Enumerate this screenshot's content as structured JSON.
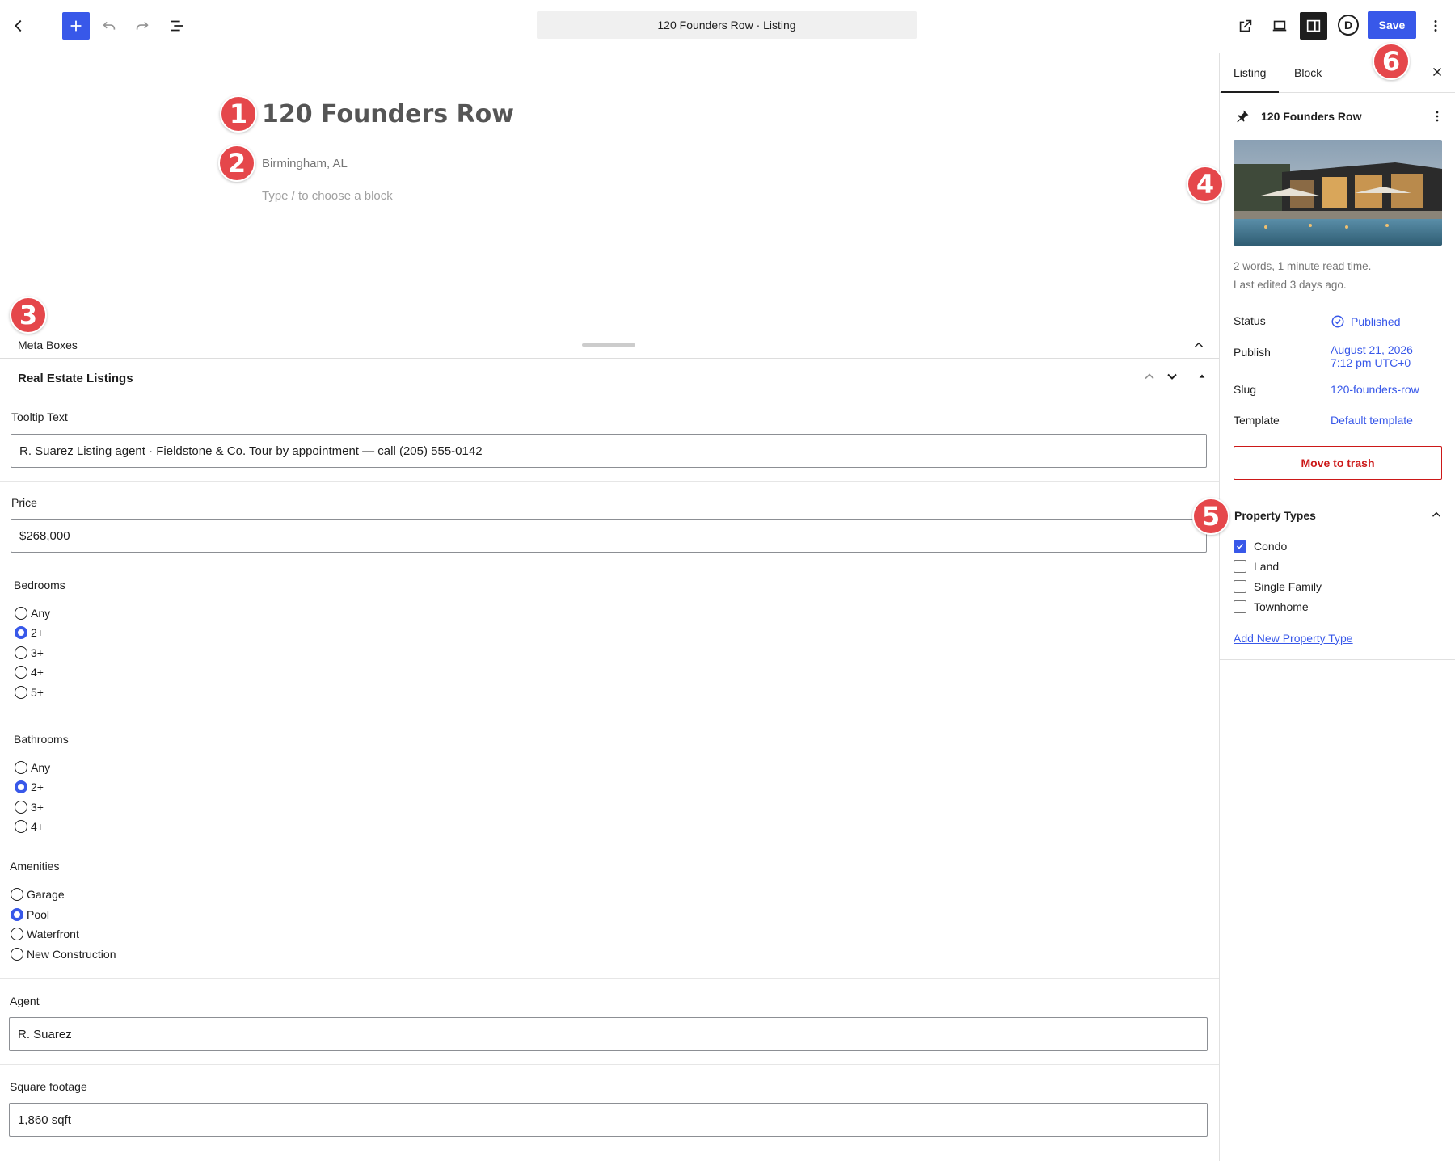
{
  "header": {
    "document_title": "120 Founders Row · Listing",
    "save_label": "Save",
    "avatar_letter": "D"
  },
  "editor": {
    "title": "120 Founders Row",
    "subtitle": "Birmingham, AL",
    "placeholder": "Type / to choose a block"
  },
  "annotations": [
    "1",
    "2",
    "3",
    "4",
    "5",
    "6"
  ],
  "meta_boxes": {
    "label": "Meta Boxes",
    "box_title": "Real Estate Listings",
    "tooltip": {
      "label": "Tooltip Text",
      "value": "R. Suarez Listing agent · Fieldstone & Co. Tour by appointment — call (205) 555-0142"
    },
    "price": {
      "label": "Price",
      "value": "$268,000"
    },
    "bedrooms": {
      "label": "Bedrooms",
      "options": [
        "Any",
        "2+",
        "3+",
        "4+",
        "5+"
      ],
      "selected": "2+"
    },
    "bathrooms": {
      "label": "Bathrooms",
      "options": [
        "Any",
        "2+",
        "3+",
        "4+"
      ],
      "selected": "2+"
    },
    "amenities": {
      "label": "Amenities",
      "options": [
        "Garage",
        "Pool",
        "Waterfront",
        "New Construction"
      ],
      "selected": "Pool"
    },
    "agent": {
      "label": "Agent",
      "value": "R. Suarez"
    },
    "square_footage": {
      "label": "Square footage",
      "value": "1,860 sqft"
    }
  },
  "sidebar": {
    "tabs": [
      "Listing",
      "Block"
    ],
    "active_tab": "Listing",
    "post_title": "120 Founders Row",
    "word_count": "2 words, 1 minute read time.",
    "last_edited": "Last edited 3 days ago.",
    "status": {
      "label": "Status",
      "value": "Published"
    },
    "publish": {
      "label": "Publish",
      "date": "August 21, 2026",
      "time": "7:12 pm UTC+0"
    },
    "slug": {
      "label": "Slug",
      "value": "120-founders-row"
    },
    "template": {
      "label": "Template",
      "value": "Default template"
    },
    "trash_label": "Move to trash",
    "property_types": {
      "title": "Property Types",
      "items": [
        {
          "label": "Condo",
          "checked": true
        },
        {
          "label": "Land",
          "checked": false
        },
        {
          "label": "Single Family",
          "checked": false
        },
        {
          "label": "Townhome",
          "checked": false
        }
      ],
      "add_link": "Add New Property Type"
    }
  },
  "colors": {
    "accent": "#3858e9",
    "badge": "#e5474b",
    "danger": "#cc1818"
  }
}
